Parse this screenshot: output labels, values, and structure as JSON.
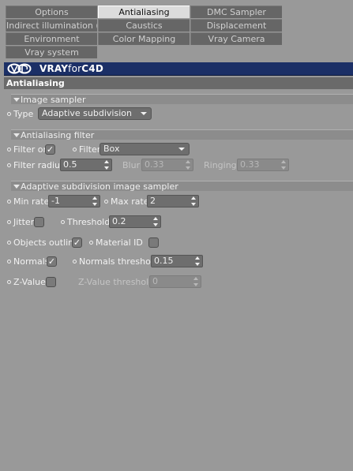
{
  "tabs": {
    "row1": [
      "Options",
      "Antialiasing",
      "DMC Sampler"
    ],
    "row2": [
      "Indirect illumination (GI)",
      "Caustics",
      "Displacement"
    ],
    "row3": [
      "Environment",
      "Color Mapping",
      "Vray Camera"
    ],
    "row4": [
      "Vray system"
    ],
    "active": "Antialiasing"
  },
  "brand": {
    "name_bold": "VRAY",
    "name_thin": "for",
    "name_tail": "C4D"
  },
  "section_title": "Antialiasing",
  "image_sampler": {
    "heading": "Image sampler",
    "type_label": "Type",
    "type_value": "Adaptive subdivision"
  },
  "aa_filter": {
    "heading": "Antialiasing filter",
    "filter_on_label": "Filter on",
    "filter_on_checked": true,
    "filter_label": "Filter",
    "filter_value": "Box",
    "filter_radius_label": "Filter radius",
    "filter_radius_value": "0.5",
    "blur_label": "Blur",
    "blur_value": "0.33",
    "ringing_label": "Ringing",
    "ringing_value": "0.33"
  },
  "adaptive": {
    "heading": "Adaptive subdivision image sampler",
    "min_rate_label": "Min rate",
    "min_rate_value": "-1",
    "max_rate_label": "Max rate",
    "max_rate_value": "2",
    "jitter_label": "Jitter",
    "jitter_checked": false,
    "threshold_label": "Threshold",
    "threshold_value": "0.2",
    "objects_outline_label": "Objects outline",
    "objects_outline_checked": true,
    "material_id_label": "Material ID",
    "material_id_checked": false,
    "normals_label": "Normals",
    "normals_checked": true,
    "normals_threshold_label": "Normals threshold",
    "normals_threshold_value": "0.15",
    "zvalue_label": "Z-Value",
    "zvalue_checked": false,
    "zvalue_threshold_label": "Z-Value threshold",
    "zvalue_threshold_value": "0"
  },
  "check_glyph": "✓",
  "colors": {
    "brand_bar": "#1b2f66",
    "panel_bg": "#999999",
    "active_tab": "#dcdcdc"
  }
}
